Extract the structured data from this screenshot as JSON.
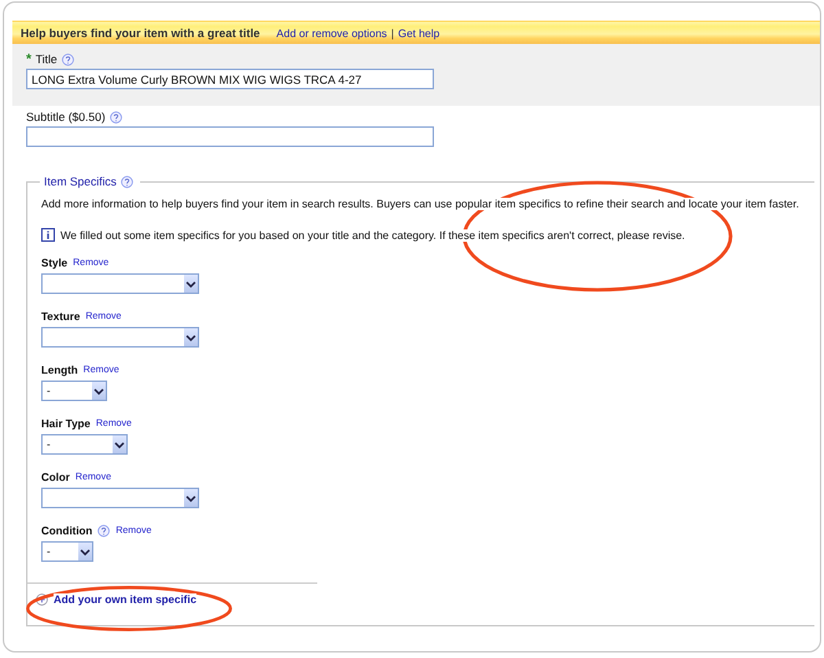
{
  "header": {
    "title": "Help buyers find your item with a great title",
    "links": [
      "Add or remove options",
      "Get help"
    ],
    "separator": "|"
  },
  "title_field": {
    "label": "Title",
    "required_mark": "*",
    "value": "LONG Extra Volume Curly BROWN MIX WIG WIGS TRCA 4-27"
  },
  "subtitle_field": {
    "label": "Subtitle ($0.50)"
  },
  "item_specifics": {
    "legend": "Item Specifics",
    "intro": "Add more information to help buyers find your item in search results. Buyers can use popular item specifics to refine their search and locate your item faster.",
    "info": "We filled out some item specifics for you based on your title and the category. If these item specifics aren't correct, please revise.",
    "fields": [
      {
        "label": "Style",
        "remove": "Remove",
        "kind": "wide",
        "help": false
      },
      {
        "label": "Texture",
        "remove": "Remove",
        "kind": "wide",
        "help": false
      },
      {
        "label": "Length",
        "remove": "Remove",
        "kind": "small",
        "value": "-",
        "help": false
      },
      {
        "label": "Hair Type",
        "remove": "Remove",
        "kind": "medium",
        "value": "-",
        "help": false
      },
      {
        "label": "Color",
        "remove": "Remove",
        "kind": "wide",
        "help": false
      },
      {
        "label": "Condition",
        "remove": "Remove",
        "kind": "tiny",
        "value": "-",
        "help": true
      }
    ],
    "add_link": "Add your own item specific"
  }
}
